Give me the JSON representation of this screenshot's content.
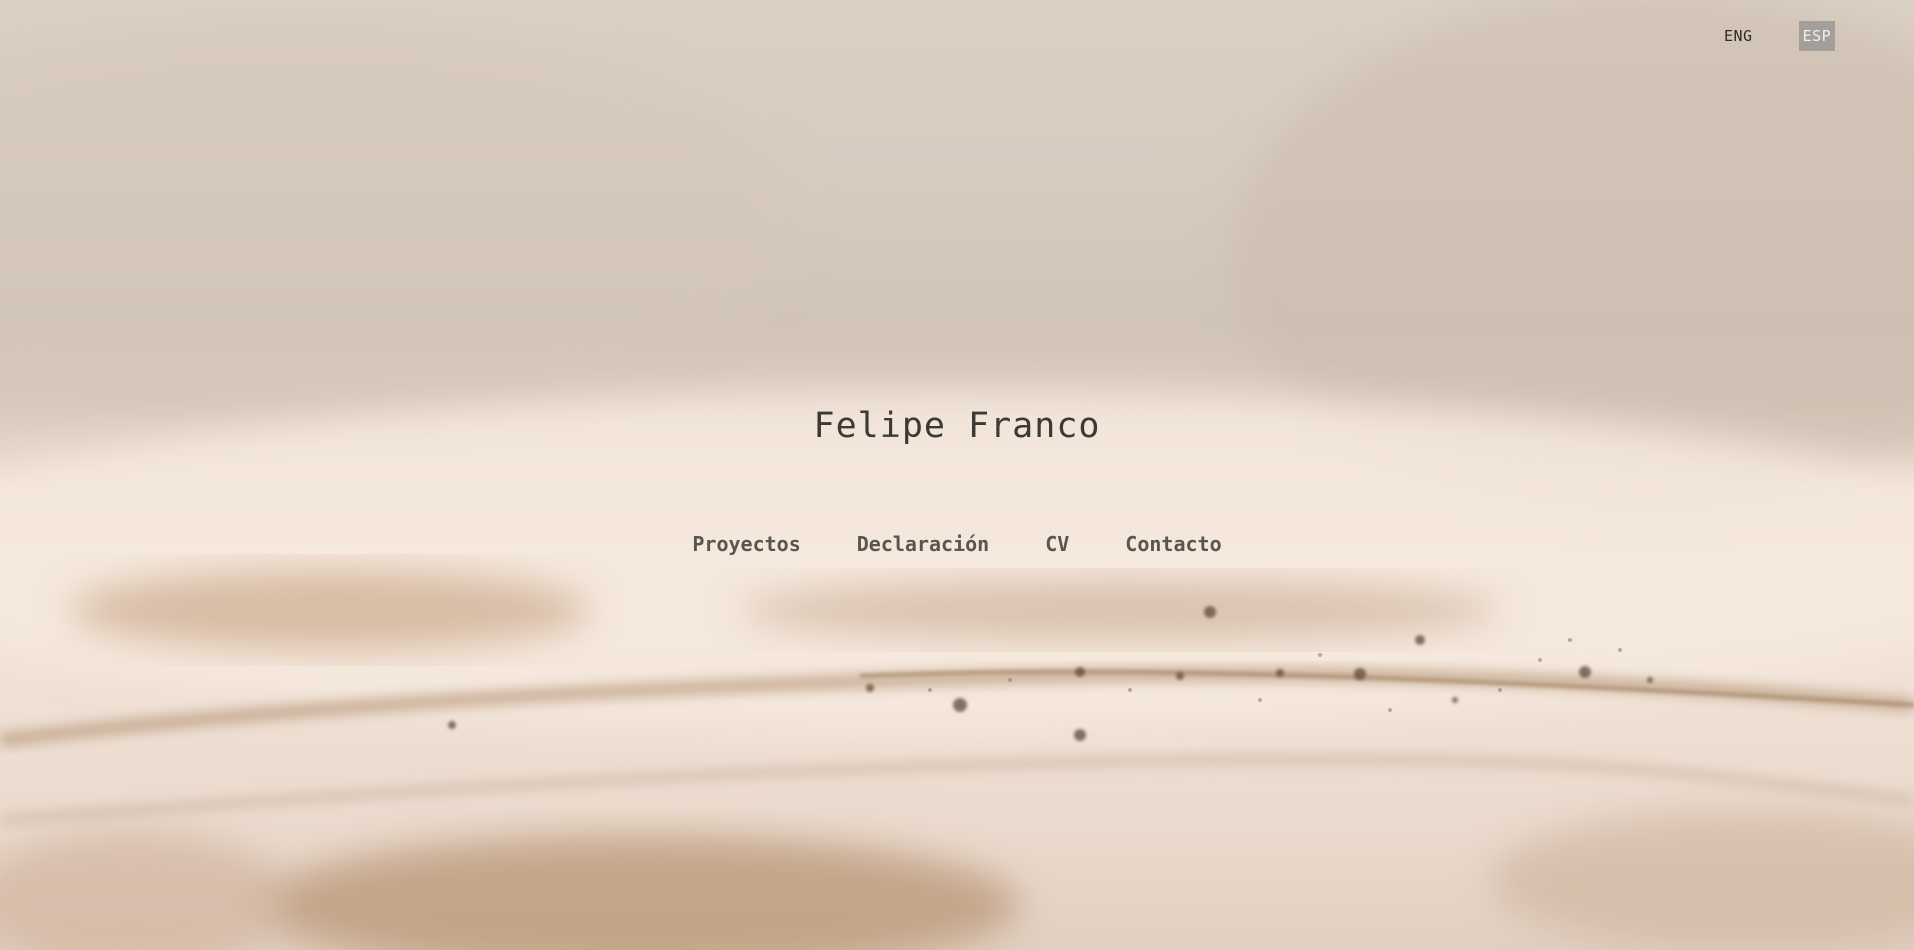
{
  "language_switch": {
    "options": [
      {
        "label": "ENG",
        "active": false
      },
      {
        "label": "ESP",
        "active": true
      }
    ]
  },
  "site_title": "Felipe Franco",
  "nav": {
    "items": [
      {
        "label": "Proyectos"
      },
      {
        "label": "Declaración"
      },
      {
        "label": "CV"
      },
      {
        "label": "Contacto"
      }
    ]
  },
  "colors": {
    "background_top": "#d8ccc1",
    "background_bottom": "#f4e6db",
    "text": "#3d3935",
    "nav_text": "#5b5550",
    "active_lang_bg": "#a49f9b"
  }
}
